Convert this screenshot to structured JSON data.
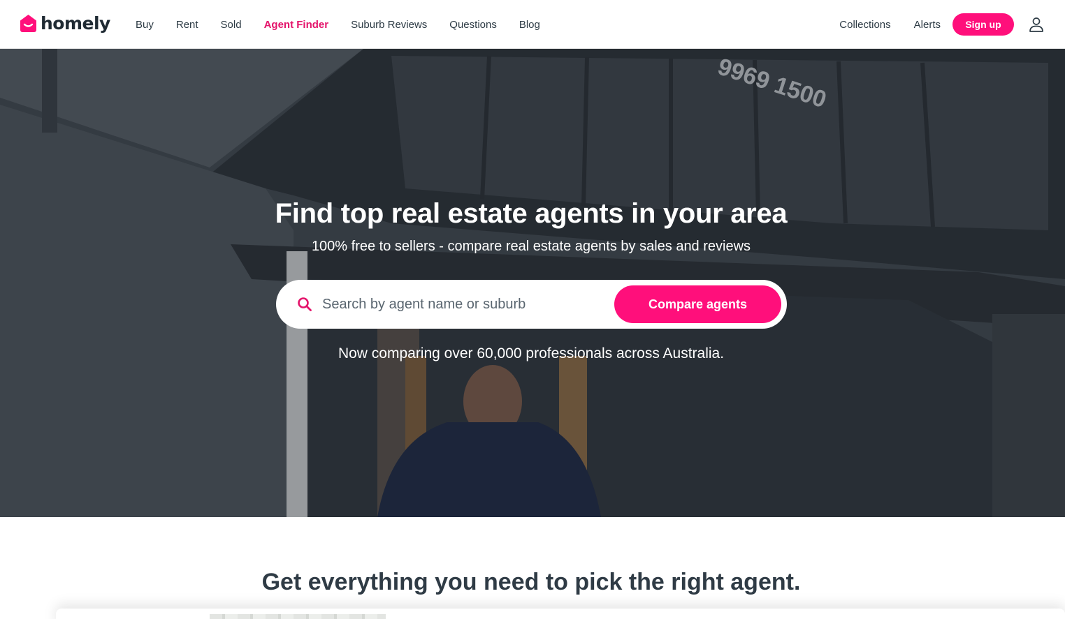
{
  "brand": {
    "name": "homely",
    "accent": "#ff0f7b",
    "accent_text": "#e4146b"
  },
  "nav": {
    "items": [
      {
        "label": "Buy"
      },
      {
        "label": "Rent"
      },
      {
        "label": "Sold"
      },
      {
        "label": "Agent Finder",
        "active": true
      },
      {
        "label": "Suburb Reviews"
      },
      {
        "label": "Questions"
      },
      {
        "label": "Blog"
      }
    ],
    "right": {
      "collections": "Collections",
      "alerts": "Alerts",
      "signup": "Sign up",
      "user_icon": "user-icon"
    }
  },
  "hero": {
    "title": "Find top real estate agents in your area",
    "subtitle": "100% free to sellers - compare real estate agents by sales and reviews",
    "search": {
      "placeholder": "Search by agent name or suburb",
      "value": "",
      "icon": "search-icon"
    },
    "cta": "Compare agents",
    "count_text": "Now comparing over 60,000 professionals across Australia."
  },
  "section": {
    "title": "Get everything you need to pick the right agent."
  }
}
